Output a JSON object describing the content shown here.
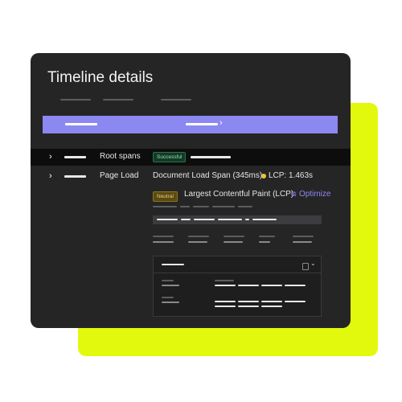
{
  "header": {
    "title": "Timeline details"
  },
  "rows": {
    "root": {
      "label": "Root spans",
      "status": "Successful"
    },
    "page": {
      "label": "Page Load",
      "span": "Document Load Span (345ms)",
      "metric": "LCP: 1.463s",
      "badge": "Neutral",
      "detail": "Largest Contentful Paint (LCP)",
      "action": "Optimize"
    }
  },
  "colors": {
    "accent": "#8b88f2",
    "card": "#262526",
    "highlight": "#e2f90e",
    "success": "#9ddfb7",
    "warning": "#e8c436"
  }
}
